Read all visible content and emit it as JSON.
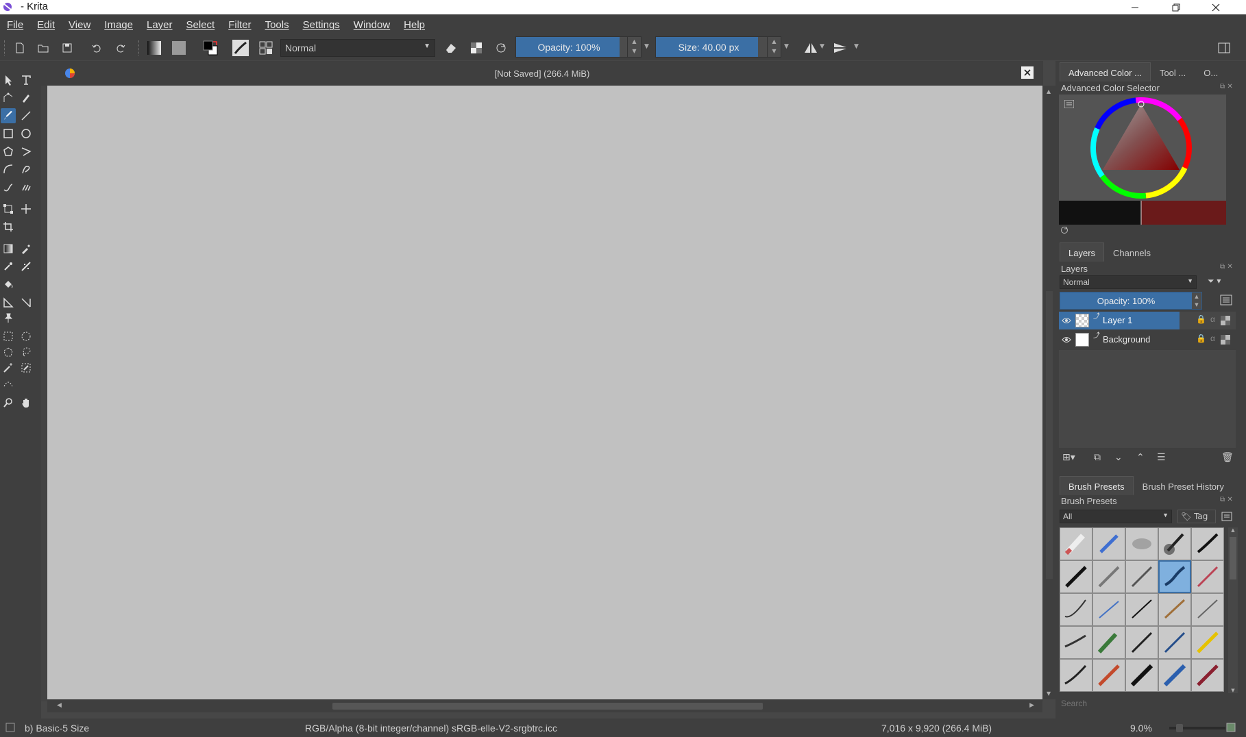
{
  "window": {
    "title": "- Krita"
  },
  "menu": [
    "File",
    "Edit",
    "View",
    "Image",
    "Layer",
    "Select",
    "Filter",
    "Tools",
    "Settings",
    "Window",
    "Help"
  ],
  "toolbar": {
    "blend_mode": "Normal",
    "opacity_label": "Opacity: 100%",
    "opacity_value": 1.0,
    "size_label": "Size: 40.00 px"
  },
  "document": {
    "title": "[Not Saved]  (266.4 MiB)"
  },
  "dock": {
    "top_tabs": [
      "Advanced Color ...",
      "Tool ...",
      "O..."
    ],
    "color_selector_title": "Advanced Color Selector",
    "layer_tabs": [
      "Layers",
      "Channels"
    ],
    "layers_title": "Layers",
    "layers_blend": "Normal",
    "layers_opacity": "Opacity:  100%",
    "layers": [
      {
        "name": "Layer 1",
        "selected": true
      },
      {
        "name": "Background",
        "selected": false
      }
    ],
    "brush_tabs": [
      "Brush Presets",
      "Brush Preset History"
    ],
    "brush_title": "Brush Presets",
    "brush_filter": "All",
    "tag_label": "Tag",
    "search_placeholder": "Search"
  },
  "status": {
    "brush": "b) Basic-5 Size",
    "colorspace": "RGB/Alpha (8-bit integer/channel)  sRGB-elle-V2-srgbtrc.icc",
    "dims": "7,016 x 9,920 (266.4 MiB)",
    "zoom": "9.0%"
  },
  "colors": {
    "accent": "#3b6fa5",
    "panel": "#3f3f3f",
    "canvas": "#c1c1c1"
  }
}
